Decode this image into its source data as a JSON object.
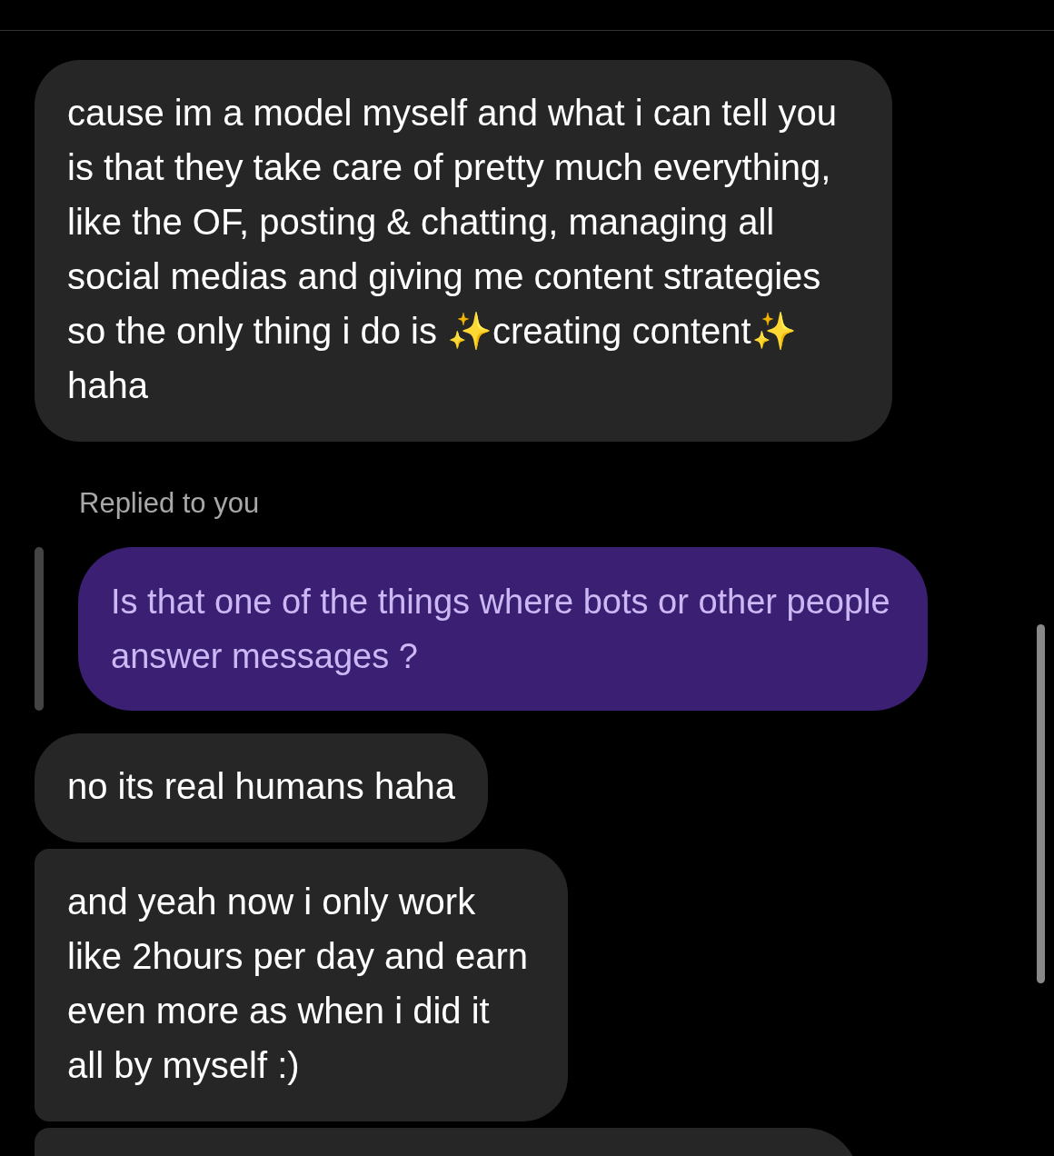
{
  "messages": [
    {
      "kind": "received",
      "text": "cause im a model myself and what i can tell you is that they take care of pretty much everything, like the OF, posting & chatting, managing all social medias and giving me content strategies so the only thing i do is ✨creating content✨ haha"
    },
    {
      "kind": "reply_label",
      "text": "Replied to you"
    },
    {
      "kind": "sent",
      "text": "Is that one of the things where bots or other people answer messages ?"
    },
    {
      "kind": "received",
      "text": "no its real humans haha"
    },
    {
      "kind": "received",
      "text": "and yeah now i only work like 2hours per day and earn even more as when i did it all by myself :)"
    },
    {
      "kind": "partial"
    }
  ]
}
